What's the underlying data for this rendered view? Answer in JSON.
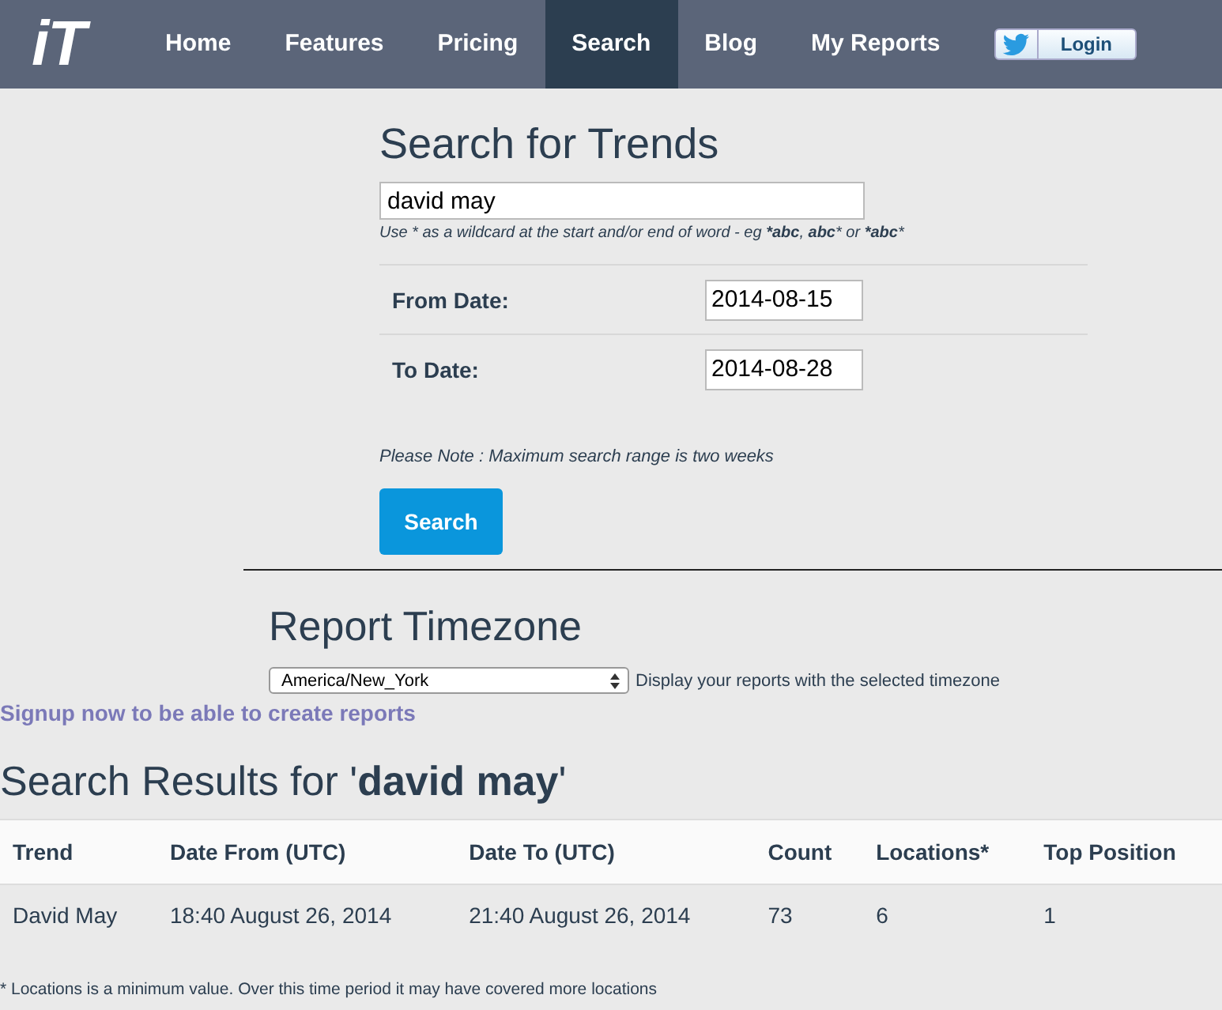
{
  "nav": {
    "logo": "iT",
    "items": [
      {
        "label": "Home",
        "selected": false
      },
      {
        "label": "Features",
        "selected": false
      },
      {
        "label": "Pricing",
        "selected": false
      },
      {
        "label": "Search",
        "selected": true
      },
      {
        "label": "Blog",
        "selected": false
      },
      {
        "label": "My Reports",
        "selected": false
      }
    ],
    "login": "Login"
  },
  "search_form": {
    "title": "Search for Trends",
    "query": "david may",
    "hint": "Use * as a wildcard at the start and/or end of word - eg ***abc**, **abc*** or ***abc***",
    "dates": [
      {
        "label": "From Date:",
        "value": "2014-08-15"
      },
      {
        "label": "To Date:",
        "value": "2014-08-28"
      }
    ],
    "note": "Please Note : Maximum search range is two weeks",
    "button": "Search"
  },
  "timezone": {
    "title": "Report Timezone",
    "value": "America/New_York",
    "description": "Display your reports with the selected timezone"
  },
  "signup_link": "Signup now to be able to create reports",
  "results": {
    "title": "Search Results for '**david may**'",
    "columns": [
      "Trend",
      "Date From (UTC)",
      "Date To (UTC)",
      "Count",
      "Locations*",
      "Top Position"
    ],
    "rows": [
      [
        "David May",
        "18:40 August 26, 2014",
        "21:40 August 26, 2014",
        "73",
        "6",
        "1"
      ]
    ],
    "footnote": "* Locations is a minimum value. Over this time period it may have covered more locations"
  }
}
